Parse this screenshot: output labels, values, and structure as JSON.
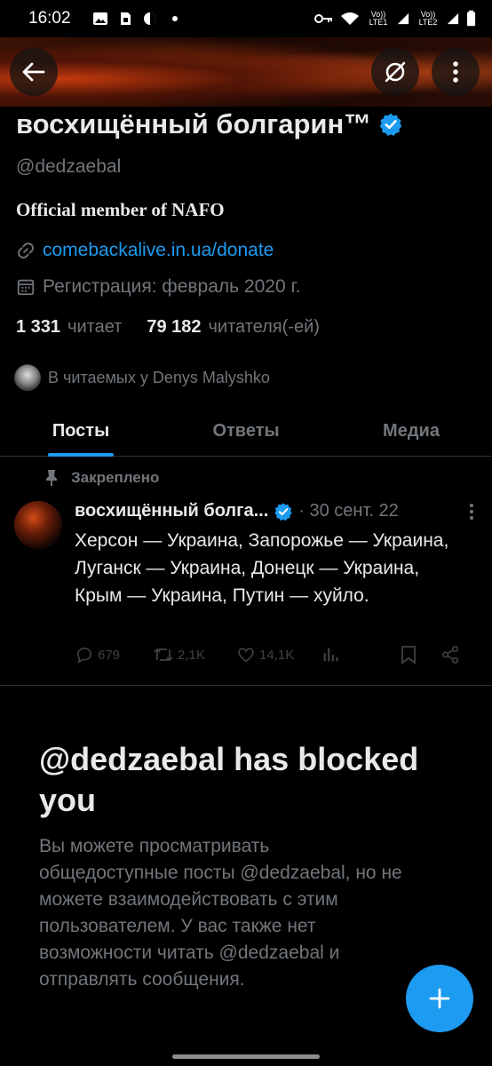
{
  "status_bar": {
    "time": "16:02",
    "volte1": "Vo)) LTE1",
    "volte2": "Vo)) LTE2",
    "icons": [
      "gallery-icon",
      "sim-icon",
      "data-saver-icon",
      "dot-icon",
      "key-icon",
      "wifi-icon",
      "signal-icon",
      "battery-icon"
    ]
  },
  "header": {
    "back_icon": "arrow-left-icon",
    "grok_icon": "circle-slash-icon",
    "more_icon": "more-vertical-icon"
  },
  "profile": {
    "display_name": "восхищённый болгарин™",
    "handle": "@dedzaebal",
    "bio": "Official member of NAFO",
    "link": "comebackalive.in.ua/donate",
    "joined": "Регистрация: февраль 2020 г.",
    "following_count": "1 331",
    "following_label": "читает",
    "followers_count": "79 182",
    "followers_label": "читателя(-ей)",
    "followed_by": "В читаемых у Denys Malyshko",
    "verified_color": "#1d9bf0"
  },
  "tabs": [
    {
      "label": "Посты",
      "active": true
    },
    {
      "label": "Ответы",
      "active": false
    },
    {
      "label": "Медиа",
      "active": false
    }
  ],
  "pinned_post": {
    "pinned_label": "Закреплено",
    "author": "восхищённый болга...",
    "date": "· 30 сент. 22",
    "text": "Херсон — Украина, Запорожье — Украина, Луганск — Украина, Донецк — Украина, Крым — Украина, Путин — хуйло.",
    "replies": "679",
    "reposts": "2,1K",
    "likes": "14,1K"
  },
  "blocked": {
    "title": "@dedzaebal has blocked you",
    "description": "Вы можете просматривать общедоступные посты @dedzaebal, но не можете взаимодействовать с этим пользователем. У вас также нет возможности читать @dedzaebal и отправлять сообщения."
  },
  "fab": {
    "icon": "plus-icon"
  },
  "colors": {
    "accent": "#1d9bf0",
    "background": "#000000",
    "muted": "#71767b"
  }
}
